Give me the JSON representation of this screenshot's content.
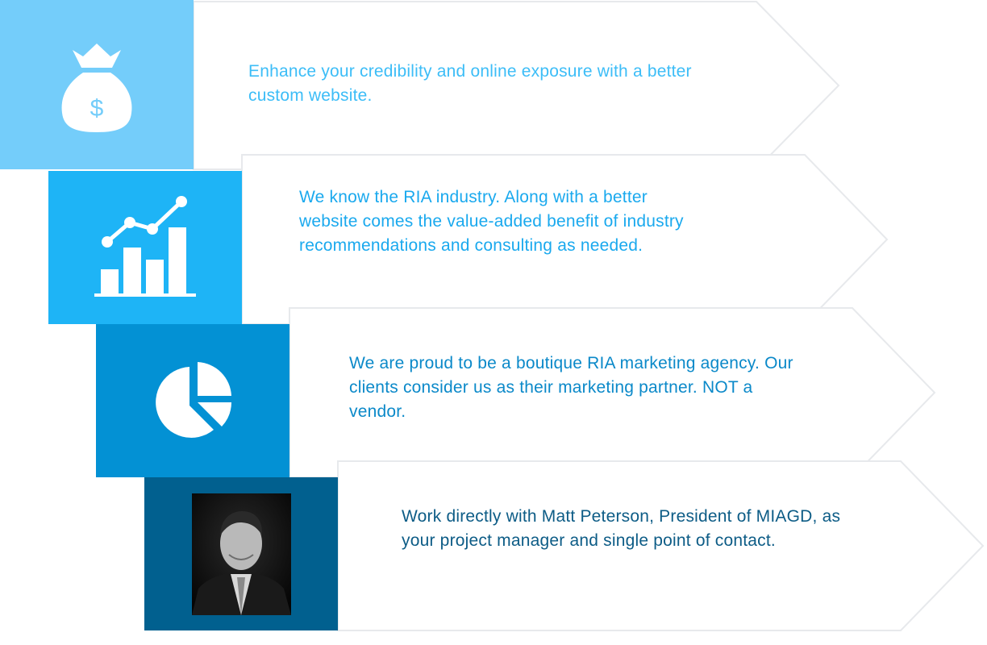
{
  "colors": {
    "tile_1": "#74cdfa",
    "tile_2": "#1eb4f6",
    "tile_3": "#0391d4",
    "tile_4": "#01608f",
    "text_1": "#3cbdf7",
    "text_2": "#1aa9ee",
    "text_3": "#0b89c9",
    "text_4": "#0d5c86"
  },
  "features": [
    {
      "icon": "money-bag-icon",
      "text": "Enhance your credibility and online exposure with a better custom website."
    },
    {
      "icon": "bar-line-chart-icon",
      "text": "We know the RIA industry. Along with a better website comes the value-added benefit of industry recommendations and consulting as needed."
    },
    {
      "icon": "pie-chart-icon",
      "text": "We are proud to be a boutique RIA marketing agency.  Our clients consider us as their marketing partner. NOT a vendor."
    },
    {
      "icon": "president-photo",
      "text": "Work directly with Matt Peterson, President of MIAGD, as your project manager and single point of contact."
    }
  ]
}
